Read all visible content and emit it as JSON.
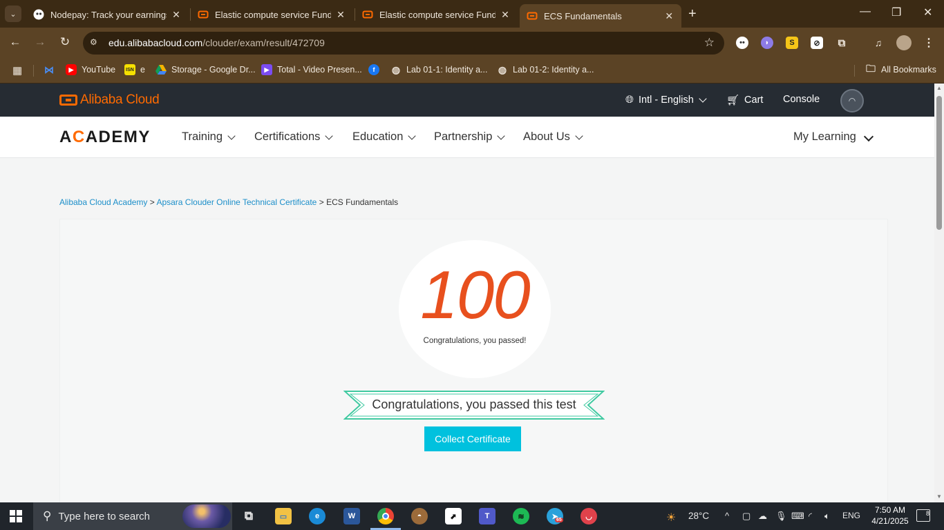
{
  "browser": {
    "tabs": [
      {
        "title": "Nodepay: Track your earnings",
        "favicon": "nodepay-icon",
        "active": false
      },
      {
        "title": "Elastic compute service Fundam",
        "favicon": "alibaba-cloud-icon",
        "active": false
      },
      {
        "title": "Elastic compute service Fundam",
        "favicon": "alibaba-cloud-icon",
        "active": false
      },
      {
        "title": "ECS Fundamentals",
        "favicon": "alibaba-cloud-icon",
        "active": true
      }
    ],
    "url_host": "edu.alibabacloud.com",
    "url_path": "/clouder/exam/result/472709",
    "bookmarks": [
      {
        "label": "",
        "icon": "mail-icon"
      },
      {
        "label": "YouTube",
        "icon": "youtube-icon"
      },
      {
        "label": "e",
        "icon": "bookmark-e-icon"
      },
      {
        "label": "Storage - Google Dr...",
        "icon": "google-drive-icon"
      },
      {
        "label": "Total - Video Presen...",
        "icon": "video-icon"
      },
      {
        "label": "",
        "icon": "facebook-icon"
      },
      {
        "label": "Lab 01-1: Identity a...",
        "icon": "globe-icon"
      },
      {
        "label": "Lab 01-2: Identity a...",
        "icon": "globe-icon"
      }
    ],
    "all_bookmarks": "All Bookmarks"
  },
  "site": {
    "brand": "Alibaba Cloud",
    "language": "Intl - English",
    "cart": "Cart",
    "console": "Console",
    "academy_logo": "ACADEMY",
    "nav": [
      "Training",
      "Certifications",
      "Education",
      "Partnership",
      "About Us"
    ],
    "my_learning": "My Learning"
  },
  "breadcrumb": {
    "items": [
      "Alibaba Cloud Academy",
      "Apsara Clouder Online Technical Certificate"
    ],
    "current": "ECS Fundamentals",
    "separator": ">"
  },
  "result": {
    "score": "100",
    "score_message": "Congratulations, you passed!",
    "banner_text": "Congratulations, you passed this test",
    "collect_button": "Collect Certificate"
  },
  "taskbar": {
    "search_placeholder": "Type here to search",
    "temperature": "28°C",
    "language": "ENG",
    "time": "7:50 AM",
    "date": "4/21/2025",
    "notifications": "8",
    "telegram_badge": "65"
  },
  "colors": {
    "accent_orange": "#ff6a00",
    "score_red": "#e8501e",
    "button_cyan": "#00c1de",
    "ribbon_green": "#3fc9a0",
    "link_blue": "#1b8ec9"
  }
}
